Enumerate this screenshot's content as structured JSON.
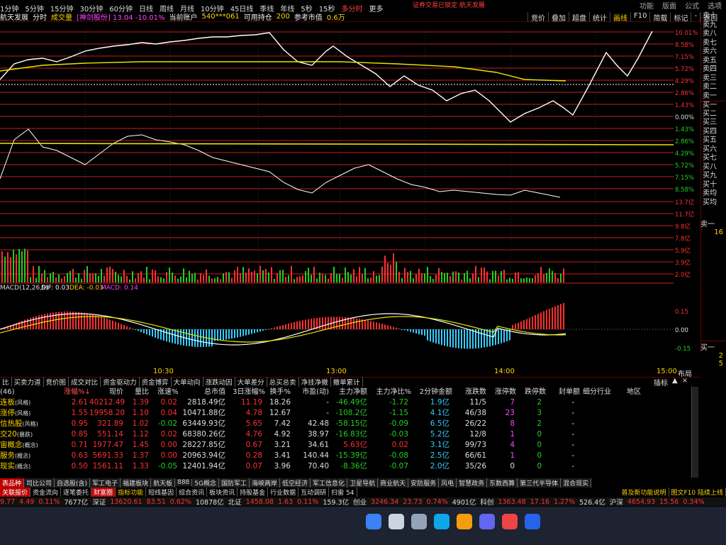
{
  "period_bar": {
    "items": [
      "1分钟",
      "5分钟",
      "15分钟",
      "30分钟",
      "60分钟",
      "日线",
      "周线",
      "月线",
      "10分钟",
      "45日线",
      "季线",
      "年线",
      "5秒",
      "15秒",
      "多分时",
      "更多"
    ],
    "selected": "多分时",
    "alert": "证券交易已锁定 航天发展",
    "window_links": [
      "功能",
      "版面",
      "公式",
      "选项"
    ]
  },
  "title_bar": {
    "stock": "航天发展",
    "tab1": "分时",
    "tab2": "成交量",
    "info": "[神剑股份] 13.04 -10.01%",
    "account_label": "当前账户",
    "account": "540***061",
    "position_label": "可用持仓",
    "position": "200",
    "mv_label": "参考市值",
    "mv": "0.6万"
  },
  "right_tools": [
    "竞价",
    "叠加",
    "超盘",
    "统计",
    "画线",
    "F10",
    "简载",
    "标记",
    "-",
    "返回"
  ],
  "main_axis_labels": [
    "10.01%",
    "8.58%",
    "7.15%",
    "5.72%",
    "4.29%",
    "2.86%",
    "1.43%",
    "0.00%",
    "1.43%",
    "2.86%",
    "4.29%",
    "5.72%",
    "7.15%",
    "8.58%"
  ],
  "volume_axis_labels": [
    "13.7亿",
    "11.7亿",
    "9.8亿",
    "7.8亿",
    "5.9亿",
    "3.9亿",
    "2.0亿"
  ],
  "macd": {
    "label": "MACD(12,26,9)",
    "dif_label": "DIF:",
    "dif": "0.03",
    "dea_label": "DEA:",
    "dea": "-0.03",
    "macd_label": "MACD:",
    "macd": "0.14",
    "axis": [
      "0.15",
      "0.00",
      "-0.15"
    ]
  },
  "time_axis": [
    "10:30",
    "13:00",
    "14:00",
    "15:00"
  ],
  "time_axis_right": "布局",
  "orderbook": {
    "sell": [
      "卖十",
      "卖九",
      "卖八",
      "卖七",
      "卖六",
      "卖五",
      "卖四",
      "卖三",
      "卖二",
      "卖一"
    ],
    "buy": [
      "买一",
      "买二",
      "买三",
      "买四",
      "买五",
      "买六",
      "买七",
      "买八",
      "买九",
      "买十"
    ],
    "avg": [
      "卖均",
      "买均"
    ],
    "sell1_label": "卖一",
    "sell1_vol": "16",
    "buy1_label": "买一",
    "buy1_vol1": "2",
    "buy1_vol2": "5"
  },
  "table_tabs": [
    "比",
    "买卖力道",
    "竞价图",
    "成交对比",
    "资金驱动力",
    "资金博弈",
    "大单动向",
    "涨跌动因",
    "大单差分",
    "总买总卖",
    "净挂净撤",
    "撤单累计"
  ],
  "table_tools": [
    "插标",
    "▲",
    "×"
  ],
  "table": {
    "headers": {
      "name": "(46)",
      "chg": "涨幅%↓",
      "px": "现价",
      "vr": "量比",
      "spd": "涨速%",
      "mcap": "总市值",
      "d3": "3日涨幅%",
      "to": "换手%",
      "pe": "市盈(动)",
      "net": "主力净额",
      "netp": "主力净比%",
      "m2": "2分钟金额",
      "ud": "涨跌数",
      "lu": "涨停数",
      "ld": "跌停数",
      "seal": "封单额",
      "ind": "细分行业",
      "reg": "地区"
    },
    "rows": [
      {
        "name": "连板",
        "tag": "(风格)",
        "chg": "2.61",
        "px": "40212.49",
        "vr": "1.39",
        "spd": "0.02",
        "mcap": "2818.49亿",
        "d3": "11.19",
        "to": "18.26",
        "pe": "-",
        "net": "-46.49亿",
        "netp": "-1.72",
        "m2": "1.9亿",
        "ud": "11/5",
        "lu": "7",
        "ld": "2",
        "seal": "-"
      },
      {
        "name": "涨停",
        "tag": "(风格)",
        "chg": "1.55",
        "px": "19958.20",
        "vr": "1.10",
        "spd": "0.04",
        "mcap": "10471.88亿",
        "d3": "4.78",
        "to": "12.67",
        "pe": "-",
        "net": "-108.2亿",
        "netp": "-1.15",
        "m2": "4.1亿",
        "ud": "46/38",
        "lu": "23",
        "ld": "3",
        "seal": "-"
      },
      {
        "name": "信热股",
        "tag": "(风格)",
        "chg": "0.95",
        "px": "321.89",
        "vr": "1.02",
        "spd": "-0.02",
        "mcap": "63449.93亿",
        "d3": "5.65",
        "to": "7.42",
        "pe": "42.48",
        "net": "-58.15亿",
        "netp": "-0.09",
        "m2": "6.5亿",
        "ud": "26/22",
        "lu": "8",
        "ld": "2",
        "seal": "-"
      },
      {
        "name": "交20",
        "tag": "(暴跌)",
        "chg": "0.85",
        "px": "551.14",
        "vr": "1.12",
        "spd": "0.02",
        "mcap": "68380.26亿",
        "d3": "4.76",
        "to": "4.92",
        "pe": "38.97",
        "net": "-16.83亿",
        "netp": "-0.03",
        "m2": "5.2亿",
        "ud": "12/8",
        "lu": "1",
        "ld": "0",
        "seal": "-"
      },
      {
        "name": "宙概念",
        "tag": "(概念)",
        "chg": "0.71",
        "px": "1977.47",
        "vr": "1.45",
        "spd": "0.00",
        "mcap": "28227.85亿",
        "d3": "0.67",
        "to": "3.21",
        "pe": "34.61",
        "net": "5.63亿",
        "netp": "0.02",
        "m2": "3.1亿",
        "ud": "99/73",
        "lu": "4",
        "ld": "0",
        "seal": "-"
      },
      {
        "name": "服务",
        "tag": "(概念)",
        "chg": "0.63",
        "px": "5691.33",
        "vr": "1.37",
        "spd": "0.00",
        "mcap": "20963.94亿",
        "d3": "0.28",
        "to": "3.41",
        "pe": "140.44",
        "net": "-15.39亿",
        "netp": "-0.08",
        "m2": "2.5亿",
        "ud": "66/61",
        "lu": "1",
        "ld": "0",
        "seal": "-"
      },
      {
        "name": "现实",
        "tag": "(概念)",
        "chg": "0.50",
        "px": "1561.11",
        "vr": "1.33",
        "spd": "-0.05",
        "mcap": "12401.94亿",
        "d3": "0.07",
        "to": "3.96",
        "pe": "70.40",
        "net": "-8.36亿",
        "netp": "-0.07",
        "m2": "2.0亿",
        "ud": "35/26",
        "lu": "0",
        "ld": "0",
        "seal": "-"
      }
    ]
  },
  "sector_tabs": [
    "表品种",
    "司比公司",
    "自选股(含)",
    "军工电子",
    "福建板块",
    "航天板",
    "888",
    "5G概念",
    "国防军工",
    "海峡两岸",
    "低空经济",
    "军工信息化",
    "卫星导航",
    "商业航天",
    "安防服务",
    "风电",
    "智慧政务",
    "东数西算",
    "第三代半导体",
    "混合现实"
  ],
  "func_tabs": [
    "关联报价",
    "资金流向",
    "逐笔委托",
    "财富圈",
    "指标功能",
    "短线基因",
    "综合资讯",
    "板块资讯",
    "持股基金",
    "行业数据",
    "互动调研",
    "扫雷 54"
  ],
  "func_right": "普及新功能说明",
  "func_right2": "图文F10 陆续上线",
  "status_bar": [
    {
      "t": "9.77",
      "c": "red"
    },
    {
      "t": "4.49",
      "c": "red"
    },
    {
      "t": "0.11%",
      "c": "red"
    },
    {
      "t": "7677亿",
      "c": "white"
    },
    {
      "t": "深证",
      "c": "white"
    },
    {
      "t": "13620.61",
      "c": "red"
    },
    {
      "t": "83.51",
      "c": "red"
    },
    {
      "t": "0.62%",
      "c": "red"
    },
    {
      "t": "10878亿",
      "c": "white"
    },
    {
      "t": "北证",
      "c": "white"
    },
    {
      "t": "1458.08",
      "c": "red"
    },
    {
      "t": "1.63",
      "c": "red"
    },
    {
      "t": "0.11%",
      "c": "red"
    },
    {
      "t": "159.3亿",
      "c": "white"
    },
    {
      "t": "创业",
      "c": "white"
    },
    {
      "t": "3246.34",
      "c": "red"
    },
    {
      "t": "23.73",
      "c": "red"
    },
    {
      "t": "0.74%",
      "c": "red"
    },
    {
      "t": "4901亿",
      "c": "white"
    },
    {
      "t": "科创",
      "c": "white"
    },
    {
      "t": "1363.48",
      "c": "red"
    },
    {
      "t": "17.16",
      "c": "red"
    },
    {
      "t": "1.27%",
      "c": "red"
    },
    {
      "t": "526.4亿",
      "c": "white"
    },
    {
      "t": "沪深",
      "c": "white"
    },
    {
      "t": "4654.93",
      "c": "red"
    },
    {
      "t": "15.56",
      "c": "red"
    },
    {
      "t": "0.34%",
      "c": "red"
    }
  ],
  "taskbar": {
    "clock": "",
    "icons": [
      "windows-icon",
      "search-icon",
      "taskview-icon",
      "edge-icon",
      "explorer-icon",
      "store-icon",
      "app-red-icon",
      "app-blue-icon"
    ]
  },
  "colors": {
    "up": "#ff3030",
    "down": "#20d020",
    "price_line": "#ffffff",
    "avg_line": "#e6e600",
    "grid": "#c81e1e",
    "label": "#ffd400"
  }
}
